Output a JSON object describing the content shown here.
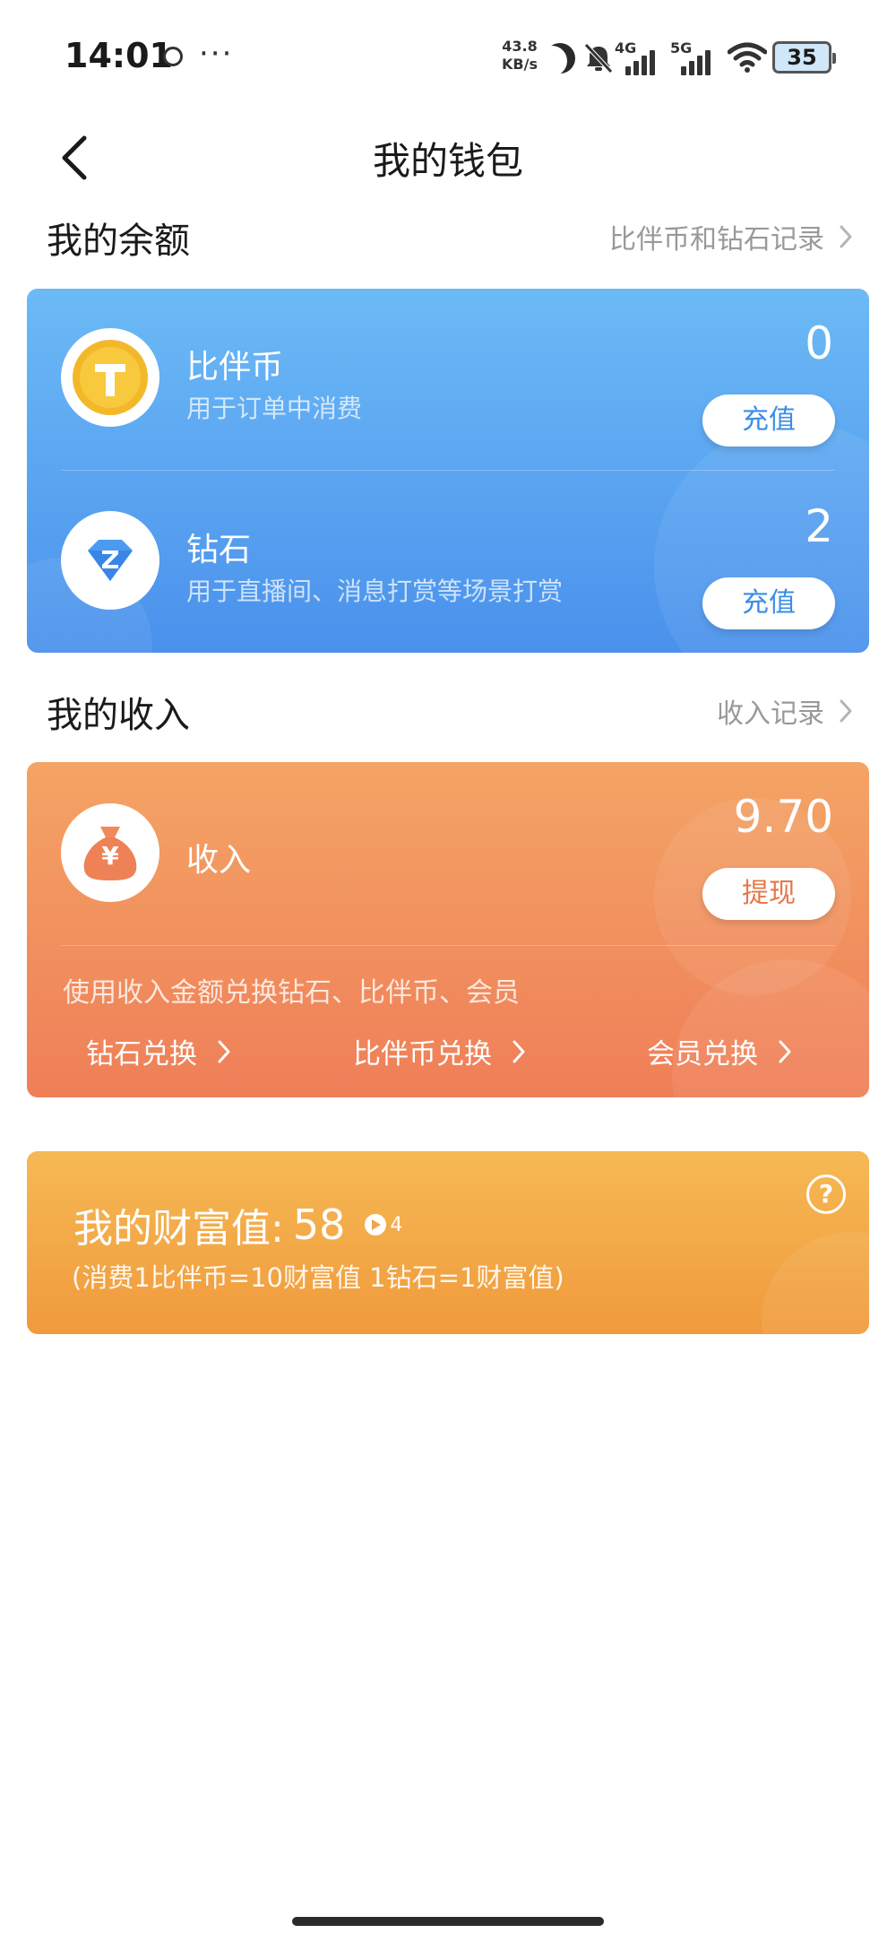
{
  "status_bar": {
    "time": "14:01",
    "dots": "···",
    "net_speed_value": "43.8",
    "net_speed_unit": "KB/s",
    "signal_1_label": "4G",
    "signal_2_label": "5G",
    "battery": "35"
  },
  "nav": {
    "title": "我的钱包"
  },
  "balance": {
    "section_title": "我的余额",
    "record_link": "比伴币和钻石记录",
    "items": [
      {
        "name": "比伴币",
        "desc": "用于订单中消费",
        "amount": "0",
        "button": "充值",
        "icon_letter": "T"
      },
      {
        "name": "钻石",
        "desc": "用于直播间、消息打赏等场景打赏",
        "amount": "2",
        "button": "充值",
        "icon_letter": "Z"
      }
    ]
  },
  "income": {
    "section_title": "我的收入",
    "record_link": "收入记录",
    "name": "收入",
    "amount": "9.70",
    "button": "提现",
    "icon_symbol": "¥",
    "exchange_tip": "使用收入金额兑换钻石、比伴币、会员",
    "exchanges": [
      "钻石兑换",
      "比伴币兑换",
      "会员兑换"
    ]
  },
  "wealth": {
    "label": "我的财富值:",
    "value": "58",
    "badge": "4",
    "note": "(消费1比伴币=10财富值 1钻石=1财富值)",
    "help": "?"
  },
  "colors": {
    "balance_card_top": "#6cbaf6",
    "balance_card_bottom": "#4a91ec",
    "income_card_top": "#f4a465",
    "income_card_bottom": "#ef7e58",
    "wealth_card_top": "#f6b954",
    "wealth_card_bottom": "#f09a3d"
  }
}
